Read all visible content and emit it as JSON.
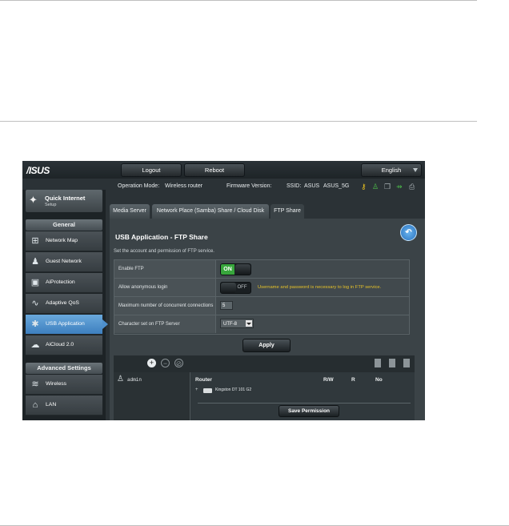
{
  "header": {
    "logo": "/ISUS",
    "logout_label": "Logout",
    "reboot_label": "Reboot",
    "language": "English"
  },
  "status": {
    "op_mode_label": "Operation Mode:",
    "op_mode_value": "Wireless router",
    "firmware_label": "Firmware Version:",
    "ssid_label": "SSID:",
    "ssid_1": "ASUS",
    "ssid_2": "ASUS_5G",
    "icons": [
      "key-icon",
      "user-icon",
      "copy-icon",
      "usb-icon",
      "printer-icon"
    ]
  },
  "sidebar": {
    "qis_title": "Quick Internet",
    "qis_sub": "Setup",
    "general_header": "General",
    "general_items": [
      {
        "label": "Network Map",
        "icon": "network-map-icon"
      },
      {
        "label": "Guest Network",
        "icon": "guest-network-icon"
      },
      {
        "label": "AiProtection",
        "icon": "lock-icon"
      },
      {
        "label": "Adaptive QoS",
        "icon": "qos-icon"
      },
      {
        "label": "USB Application",
        "icon": "puzzle-icon",
        "active": true
      },
      {
        "label": "AiCloud 2.0",
        "icon": "cloud-icon"
      }
    ],
    "advanced_header": "Advanced Settings",
    "advanced_items": [
      {
        "label": "Wireless",
        "icon": "wifi-icon"
      },
      {
        "label": "LAN",
        "icon": "home-icon"
      }
    ]
  },
  "tabs": [
    "Media Server",
    "Network Place (Samba) Share / Cloud Disk",
    "FTP Share"
  ],
  "active_tab": "FTP Share",
  "panel": {
    "title": "USB Application - FTP Share",
    "description": "Set the account and permission of FTP service.",
    "rows": {
      "enable_ftp": {
        "label": "Enable FTP",
        "state": "ON"
      },
      "anon_login": {
        "label": "Allow anonymous login",
        "state": "OFF",
        "hint": "Username and password is necessary to log in FTP service."
      },
      "max_conn": {
        "label": "Maximum number of concurrent connections",
        "value": "5"
      },
      "charset": {
        "label": "Character set on FTP Server",
        "value": "UTF-8"
      }
    },
    "apply_label": "Apply",
    "permissions": {
      "user": "admin",
      "col_router": "Router",
      "col_rw": "R/W",
      "col_r": "R",
      "col_no": "No",
      "tree_toggle": "+",
      "drive": "Kingston DT 101 G2",
      "save_label": "Save Permission"
    }
  },
  "colors": {
    "accent": "#3d7fbf",
    "on_green": "#38a63c",
    "hint_yellow": "#e6c229",
    "status_icon_yellow": "#e8c020",
    "status_icon_green": "#4cc04a"
  }
}
